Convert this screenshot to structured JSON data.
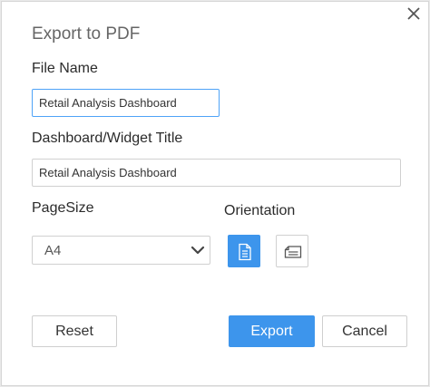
{
  "dialog": {
    "title": "Export to PDF",
    "close_icon": "close-icon"
  },
  "file_name": {
    "label": "File Name",
    "value": "Retail Analysis Dashboard"
  },
  "widget_title": {
    "label": "Dashboard/Widget Title",
    "value": "Retail Analysis Dashboard"
  },
  "page_size": {
    "label": "PageSize",
    "selected": "A4",
    "chevron_icon": "chevron-down-icon"
  },
  "orientation": {
    "label": "Orientation",
    "options": [
      {
        "name": "portrait",
        "icon": "portrait-page-icon",
        "selected": true
      },
      {
        "name": "landscape",
        "icon": "landscape-page-icon",
        "selected": false
      }
    ]
  },
  "buttons": {
    "reset": "Reset",
    "export": "Export",
    "cancel": "Cancel"
  },
  "colors": {
    "accent": "#3d95ec",
    "focus_border": "#4fa3f7",
    "title_text": "#666666"
  }
}
